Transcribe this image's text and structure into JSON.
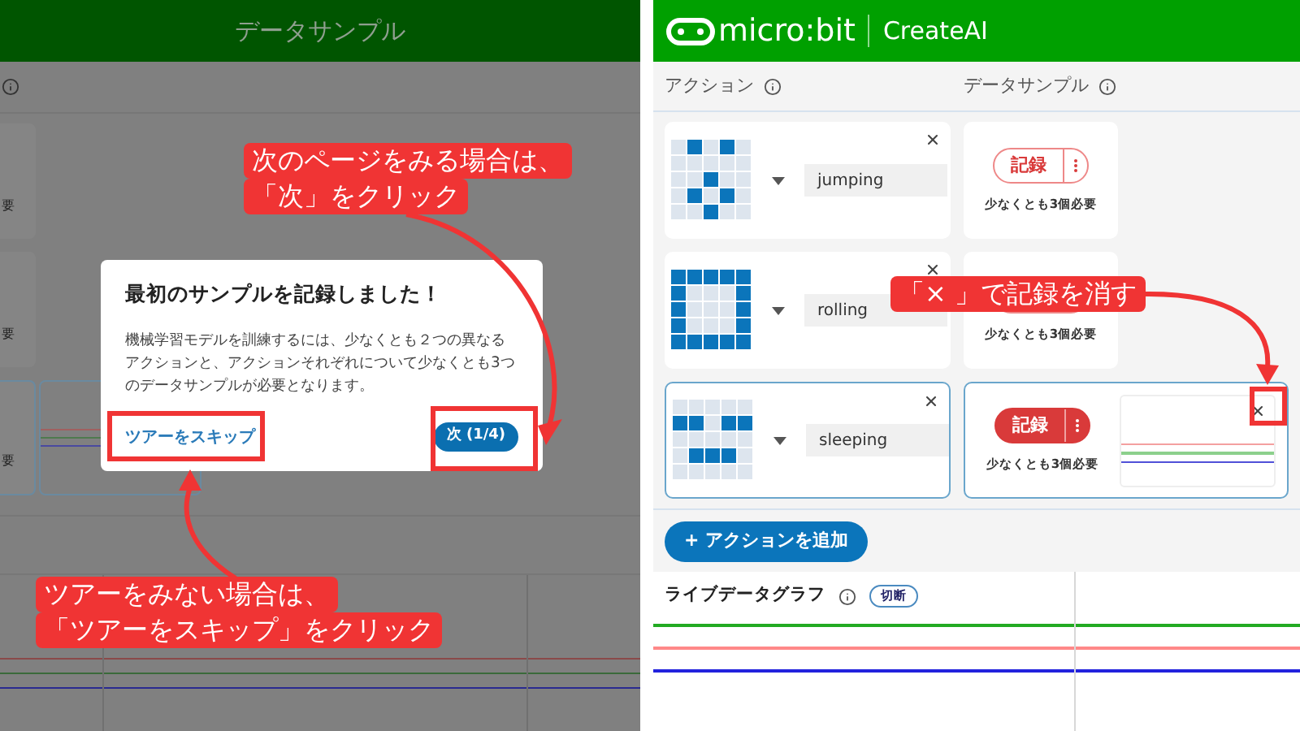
{
  "left_screen": {
    "title": "データサンプル",
    "cards": [
      {
        "note": "要",
        "selected": false
      },
      {
        "note": "要",
        "selected": false
      },
      {
        "note": "要",
        "selected": true
      }
    ],
    "dialog": {
      "title": "最初のサンプルを記録しました！",
      "body": "機械学習モデルを訓練するには、少なくとも２つの異なるアクションと、アクションそれぞれについて少なくとも3つのデータサンプルが必要となります。",
      "skip_link": "ツアーをスキップ",
      "next_button": "次 (1/4)"
    }
  },
  "right_screen": {
    "brand": "micro:bit",
    "app_name": "CreateAI",
    "columns": [
      {
        "label": "アクション"
      },
      {
        "label": "データサンプル"
      }
    ],
    "actions": [
      {
        "name": "jumping",
        "leds": [
          [
            false,
            true,
            false,
            true,
            false
          ],
          [
            false,
            false,
            false,
            false,
            false
          ],
          [
            false,
            false,
            true,
            false,
            false
          ],
          [
            false,
            true,
            false,
            true,
            false
          ],
          [
            false,
            false,
            true,
            false,
            false
          ]
        ],
        "selected": false,
        "record_label": "記録",
        "requirement": "少なくとも3個必要"
      },
      {
        "name": "rolling",
        "leds": [
          [
            true,
            true,
            true,
            true,
            true
          ],
          [
            true,
            false,
            false,
            false,
            true
          ],
          [
            true,
            false,
            false,
            false,
            true
          ],
          [
            true,
            false,
            false,
            false,
            true
          ],
          [
            true,
            true,
            true,
            true,
            true
          ]
        ],
        "selected": false,
        "requirement": "少なくとも3個必要"
      },
      {
        "name": "sleeping",
        "leds": [
          [
            false,
            false,
            false,
            false,
            false
          ],
          [
            true,
            true,
            false,
            true,
            true
          ],
          [
            false,
            false,
            false,
            false,
            false
          ],
          [
            false,
            true,
            true,
            true,
            false
          ],
          [
            false,
            false,
            false,
            false,
            false
          ]
        ],
        "selected": true,
        "record_label": "記録",
        "requirement": "少なくとも3個必要"
      }
    ],
    "add_button": "+ アクションを追加",
    "live_graph": {
      "title": "ライブデータグラフ",
      "status": "切断"
    }
  },
  "callouts": [
    {
      "lines": [
        "次のページをみる場合は、",
        "「次」をクリック"
      ]
    },
    {
      "lines": [
        "ツアーをみない場合は、",
        "「ツアーをスキップ」をクリック"
      ]
    },
    {
      "lines": [
        "「× 」で記録を消す"
      ]
    }
  ]
}
